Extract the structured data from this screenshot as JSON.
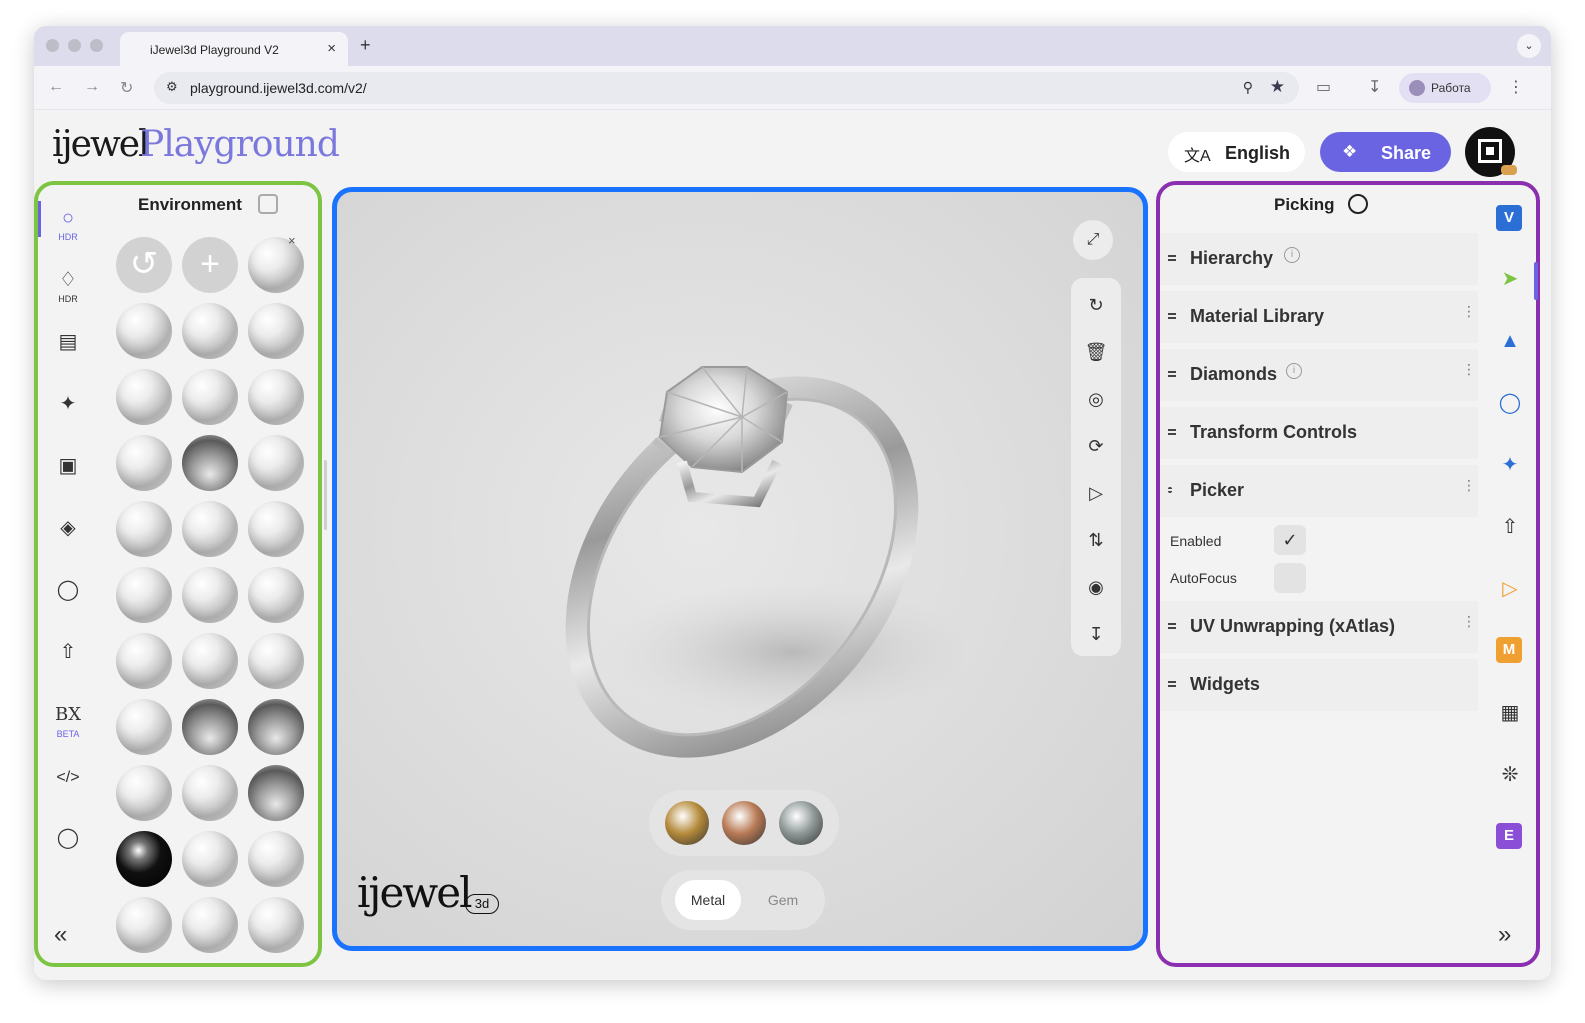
{
  "browser": {
    "tab_title": "iJewel3d Playground V2",
    "tab_close": "×",
    "new_tab": "+",
    "url": "playground.ijewel3d.com/v2/",
    "profile_label": "Работа"
  },
  "header": {
    "logo_primary": "ijewel",
    "logo_secondary": "Playground",
    "language_label": "English",
    "share_label": "Share"
  },
  "left_panel": {
    "title": "Environment",
    "rail_items": [
      {
        "icon": "hdr-sphere-icon",
        "label": "HDR"
      },
      {
        "icon": "hdr-gem-icon",
        "label": "HDR"
      },
      {
        "icon": "stripes-icon",
        "label": ""
      },
      {
        "icon": "sparkle-icon",
        "label": ""
      },
      {
        "icon": "image-icon",
        "label": ""
      },
      {
        "icon": "layers-icon",
        "label": ""
      },
      {
        "icon": "ring-icon",
        "label": ""
      },
      {
        "icon": "upload-icon",
        "label": ""
      },
      {
        "icon": "bx-icon",
        "label": "BETA"
      },
      {
        "icon": "code-icon",
        "label": ""
      },
      {
        "icon": "tag-icon",
        "label": ""
      }
    ],
    "env_close": "×",
    "collapse": "«"
  },
  "viewport": {
    "material_tabs": [
      "Metal",
      "Gem"
    ],
    "brand": "ijewel",
    "brand_suffix": "3d",
    "metal_swatches": [
      "#b58a3a",
      "#b87a55",
      "#8f9898"
    ]
  },
  "right_panel": {
    "title": "Picking",
    "sections": [
      {
        "label": "Hierarchy",
        "info": true,
        "more": false
      },
      {
        "label": "Material Library",
        "info": false,
        "more": true
      },
      {
        "label": "Diamonds",
        "info": true,
        "more": true
      },
      {
        "label": "Transform Controls",
        "info": false,
        "more": false
      },
      {
        "label": "Picker",
        "info": false,
        "more": true
      },
      {
        "label": "UV Unwrapping (xAtlas)",
        "info": false,
        "more": true
      },
      {
        "label": "Widgets",
        "info": false,
        "more": false
      }
    ],
    "picker_rows": [
      {
        "label": "Enabled",
        "checked": true
      },
      {
        "label": "AutoFocus",
        "checked": false
      }
    ],
    "rail_badges": {
      "v": "V",
      "m": "M",
      "e": "E"
    },
    "collapse": "»"
  },
  "colors": {
    "accent": "#6a64e3",
    "left_border": "#7cc442",
    "viewport_border": "#1a73ff",
    "right_border": "#8a2fb0"
  }
}
